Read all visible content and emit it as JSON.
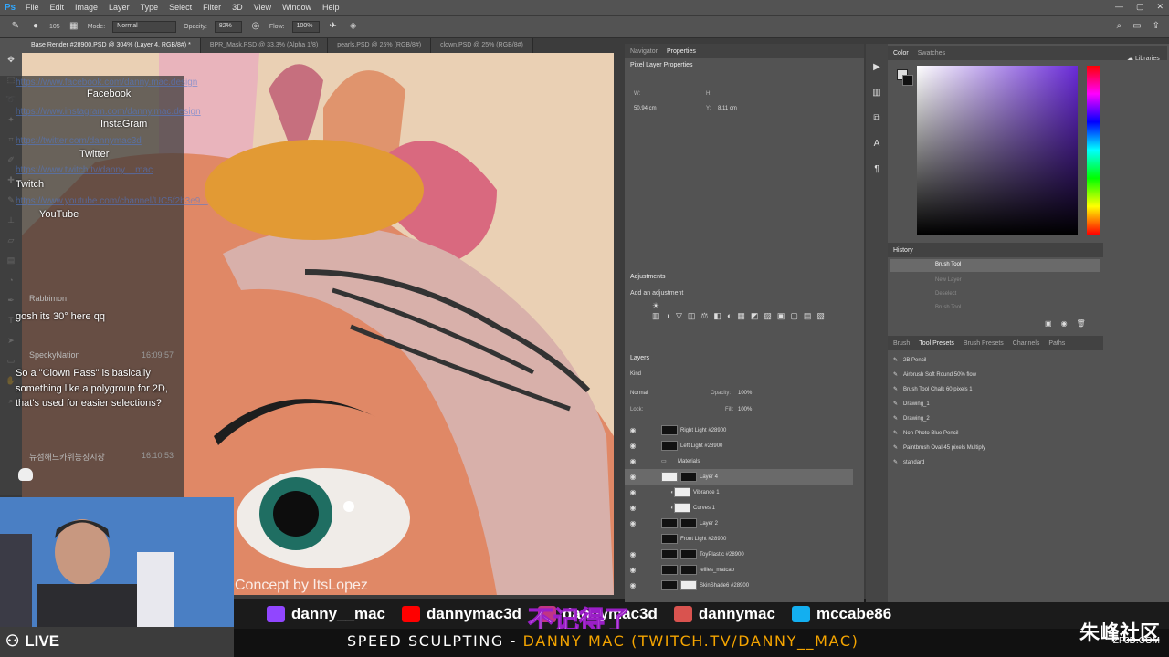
{
  "menubar": {
    "logo": "Ps",
    "items": [
      "File",
      "Edit",
      "Image",
      "Layer",
      "Type",
      "Select",
      "Filter",
      "3D",
      "View",
      "Window",
      "Help"
    ]
  },
  "options": {
    "brush_size": "105",
    "mode_label": "Mode:",
    "mode_value": "Normal",
    "opacity_label": "Opacity:",
    "opacity_value": "82%",
    "flow_label": "Flow:",
    "flow_value": "100%"
  },
  "doc_tabs": [
    "Base Render #28900.PSD @ 304% (Layer 4, RGB/8#) *",
    "BPR_Mask.PSD @ 33.3% (Alpha 1/8)",
    "pearls.PSD @ 25% (RGB/8#)",
    "clown.PSD @ 25% (RGB/8#)"
  ],
  "chat": {
    "links": [
      {
        "label": "Facebook",
        "url": "https://www.facebook.com/danny.mac.design"
      },
      {
        "label": "InstaGram",
        "url": "https://www.instagram.com/danny.mac.design"
      },
      {
        "label": "Twitter",
        "url": "https://twitter.com/dannymac3d"
      },
      {
        "label": "Twitch",
        "url": "https://www.twitch.tv/danny__mac"
      },
      {
        "label": "YouTube",
        "url": "https://www.youtube.com/channel/UC5f2b3e9..."
      }
    ],
    "messages": [
      {
        "user": "Rabbimon",
        "time": "",
        "text": "gosh its 30° here qq"
      },
      {
        "user": "SpeckyNation",
        "time": "16:09:57",
        "text": "So a \"Clown Pass\" is basically something like a polygroup for 2D, that's used for easier selections?"
      },
      {
        "user": "뉴섬해드카위능징시장",
        "time": "16:10:53",
        "text": ""
      }
    ]
  },
  "overlay": {
    "concept_credit": "Concept by ItsLopez",
    "subtitle": "不记得了",
    "live": "LIVE",
    "socials": [
      {
        "handle": "danny__mac",
        "icon": "twitch-icon",
        "color": "#9146ff"
      },
      {
        "handle": "dannymac3d",
        "icon": "youtube-icon",
        "color": "#ff0000"
      },
      {
        "handle": "dannymac3d",
        "icon": "instagram-icon",
        "color": "#c13584"
      },
      {
        "handle": "dannymac",
        "icon": "artstation-icon",
        "color": "#d9534f"
      },
      {
        "handle": "mccabe86",
        "icon": "artstation-blue-icon",
        "color": "#13aff0"
      }
    ],
    "bottom_prefix": "SPEED SCULPTING - ",
    "bottom_accent": "DANNY MAC (TWITCH.TV/DANNY__MAC)",
    "watermark": "朱峰社区",
    "watermark_url": "ZF3D.COM"
  },
  "properties": {
    "tabs": [
      "Navigator",
      "Properties"
    ],
    "title": "Pixel Layer Properties",
    "w_label": "W:",
    "h_label": "H:",
    "x_value": "50.94 cm",
    "y_label": "Y:",
    "y_value": "8.11 cm"
  },
  "adjustments": {
    "title": "Adjustments",
    "subtitle": "Add an adjustment"
  },
  "layers": {
    "title": "Layers",
    "kind": "Kind",
    "blend": "Normal",
    "opacity_label": "Opacity:",
    "opacity_value": "100%",
    "lock_label": "Lock:",
    "fill_label": "Fill:",
    "fill_value": "100%",
    "rows": [
      {
        "name": "Right Light #28900",
        "thumb": "dark"
      },
      {
        "name": "Left Light #28900",
        "thumb": "dark"
      },
      {
        "name": "Materials",
        "thumb": "folder"
      },
      {
        "name": "Layer 4",
        "thumb": "checker"
      },
      {
        "name": "Vibrance 1",
        "thumb": "white"
      },
      {
        "name": "Curves 1",
        "thumb": "white"
      },
      {
        "name": "Layer 2",
        "thumb": "dark"
      },
      {
        "name": "Front Light #28900",
        "thumb": "dark"
      },
      {
        "name": "ToyPlastic #28900",
        "thumb": "dark"
      },
      {
        "name": "jellies_matcap",
        "thumb": "dark"
      },
      {
        "name": "SkinShade6 #28900",
        "thumb": "white"
      }
    ]
  },
  "color_panel": {
    "tabs": [
      "Color",
      "Swatches"
    ],
    "libraries": "Libraries"
  },
  "history": {
    "title": "History",
    "items": [
      "Brush Tool",
      "New Layer",
      "Deselect",
      "Brush Tool"
    ]
  },
  "presets": {
    "tabs": [
      "Brush",
      "Tool Presets",
      "Brush Presets",
      "Channels",
      "Paths"
    ],
    "items": [
      "2B Pencil",
      "Airbrush Soft Round 50% flow",
      "Brush Tool Chalk 60 pixels 1",
      "Drawing_1",
      "Drawing_2",
      "Non-Photo Blue Pencil",
      "Paintbrush Oval 45 pixels Multiply",
      "standard"
    ]
  }
}
